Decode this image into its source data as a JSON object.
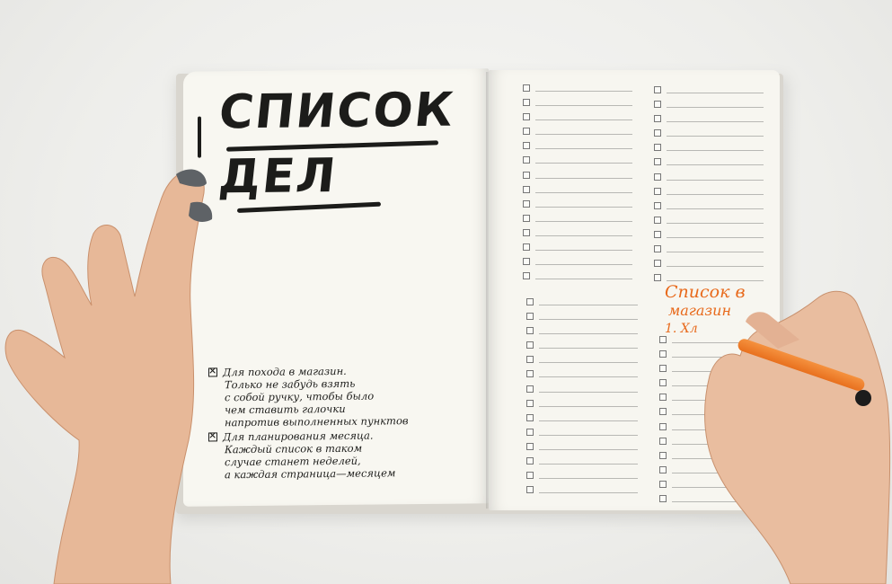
{
  "notebook": {
    "title_line1": "СПИСОК",
    "title_line2": "ДЕЛ",
    "note1": {
      "lines": [
        "Для похода в магазин.",
        "Только не забудь взять",
        "с собой ручку, чтобы было",
        "чем ставить галочки",
        "напротив выполненных пунктов"
      ]
    },
    "note2": {
      "lines": [
        "Для планирования месяца.",
        "Каждый список в таком",
        "случае станет неделей,",
        "а каждая страница—месяцем"
      ]
    },
    "handwritten_orange": {
      "line1": "Список в",
      "line2": "магазин",
      "line3": "1. Хл"
    }
  },
  "colors": {
    "ink": "#1c1c1a",
    "orange_pen": "#e86a1c",
    "page": "#f8f7f1"
  },
  "checklists": {
    "top_left_rows": 14,
    "top_right_rows": 14,
    "bottom_left_rows": 14,
    "bottom_right_rows": 12
  }
}
